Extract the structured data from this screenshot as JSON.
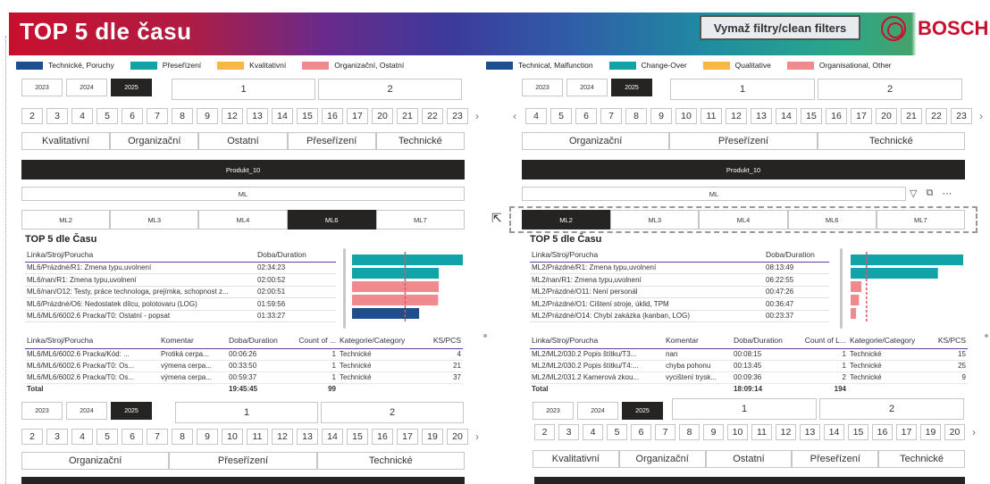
{
  "header": {
    "title": "TOP 5 dle času",
    "clear_filters_label": "Vymaž filtry/clean filters",
    "brand": "BOSCH"
  },
  "legend_cz": [
    {
      "label": "Technické, Poruchy",
      "color": "#1f4e8c"
    },
    {
      "label": "Přeseřízení",
      "color": "#12a3a9"
    },
    {
      "label": "Kvalitativní",
      "color": "#f5b942"
    },
    {
      "label": "Organizační, Ostatní",
      "color": "#f08a8f"
    }
  ],
  "legend_en": [
    {
      "label": "Technical, Malfunction",
      "color": "#1f4e8c"
    },
    {
      "label": "Change-Over",
      "color": "#12a3a9"
    },
    {
      "label": "Qualitative",
      "color": "#f5b942"
    },
    {
      "label": "Organisational, Other",
      "color": "#f08a8f"
    }
  ],
  "left": {
    "years": [
      "2023",
      "2024",
      "2025"
    ],
    "selected_year": "2025",
    "halves": [
      "1",
      "2"
    ],
    "weeks": [
      "2",
      "3",
      "4",
      "5",
      "6",
      "7",
      "8",
      "9",
      "12",
      "13",
      "14",
      "15",
      "16",
      "17",
      "20",
      "21",
      "22",
      "23"
    ],
    "categories": [
      "Kvalitativní",
      "Organizační",
      "Ostatní",
      "Přeseřízení",
      "Technické"
    ],
    "product": "Produkt_10",
    "ml_label": "ML",
    "lines": [
      "ML2",
      "ML3",
      "ML4",
      "ML6",
      "ML7"
    ],
    "selected_line": "ML6",
    "top5": {
      "title": "TOP 5 dle Času",
      "col_line": "Linka/Stroj/Porucha",
      "col_duration": "Doba/Duration",
      "rows": [
        {
          "line": "ML6/Prázdné/R1: Zmena typu,uvolnení",
          "duration": "02:34:23"
        },
        {
          "line": "ML6/nan/R1: Zmena typu,uvolnení",
          "duration": "02:00:52"
        },
        {
          "line": "ML6/nan/O12: Testy, práce technologa, prejímka, schopnost z...",
          "duration": "02:00:51"
        },
        {
          "line": "ML6/Prázdné/O6: Nedostatek dílcu, polotovaru (LOG)",
          "duration": "01:59:56"
        },
        {
          "line": "ML6/ML6/6002.6 Pracka/T0: Ostatní - popsat",
          "duration": "01:33:27"
        }
      ]
    },
    "top5_chart": {
      "values_min": [
        154.4,
        120.9,
        120.9,
        120.0,
        93.5
      ],
      "colors": [
        "#12a3a9",
        "#12a3a9",
        "#f08a8f",
        "#f08a8f",
        "#1f4e8c"
      ],
      "avg_line_min": 74
    },
    "detail": {
      "headers": [
        "Linka/Stroj/Porucha",
        "Komentar",
        "Doba/Duration",
        "Count of ...",
        "Kategorie/Category",
        "KS/PCS"
      ],
      "rows": [
        [
          "ML6/ML6/6002.6 Pracka/Kód: ...",
          "Protiká cerpa...",
          "00:06:26",
          "1",
          "Technické",
          "4"
        ],
        [
          "ML6/ML6/6002.6 Pracka/T0: Os...",
          "výmena cerpa...",
          "00:33:50",
          "1",
          "Technické",
          "21"
        ],
        [
          "ML6/ML6/6002.6 Pracka/T0: Os...",
          "výmena cerpa...",
          "00:59:37",
          "1",
          "Technické",
          "37"
        ]
      ],
      "total": [
        "Total",
        "",
        "19:45:45",
        "99",
        "",
        ""
      ]
    },
    "years2": [
      "2023",
      "2024",
      "2025"
    ],
    "selected_year2": "2025",
    "halves2": [
      "1",
      "2"
    ],
    "weeks2": [
      "2",
      "3",
      "4",
      "5",
      "6",
      "7",
      "8",
      "9",
      "10",
      "11",
      "12",
      "13",
      "14",
      "15",
      "16",
      "17",
      "19",
      "20"
    ],
    "categories2": [
      "Organizační",
      "Přeseřízení",
      "Technické"
    ]
  },
  "right": {
    "years": [
      "2023",
      "2024",
      "2025"
    ],
    "selected_year": "2025",
    "halves": [
      "1",
      "2"
    ],
    "weeks": [
      "4",
      "5",
      "6",
      "7",
      "8",
      "9",
      "10",
      "11",
      "12",
      "13",
      "14",
      "15",
      "16",
      "17",
      "20",
      "21",
      "22",
      "23"
    ],
    "categories": [
      "Organizační",
      "Přeseřízení",
      "Technické"
    ],
    "product": "Produkt_10",
    "ml_label": "ML",
    "lines": [
      "ML2",
      "ML3",
      "ML4",
      "ML6",
      "ML7"
    ],
    "selected_line": "ML2",
    "top5": {
      "title": "TOP 5 dle Času",
      "col_line": "Linka/Stroj/Porucha",
      "col_duration": "Doba/Duration",
      "rows": [
        {
          "line": "ML2/Prázdné/R1: Zmena typu,uvolnení",
          "duration": "08:13:49"
        },
        {
          "line": "ML2/nan/R1: Zmena typu,uvolnení",
          "duration": "06:22:55"
        },
        {
          "line": "ML2/Prázdné/O11: Není personál",
          "duration": "00:47:26"
        },
        {
          "line": "ML2/Prázdné/O1: Cištení stroje, úklid, TPM",
          "duration": "00:36:47"
        },
        {
          "line": "ML2/Prázdné/O14: Chybí zakázka (kanban, LOG)",
          "duration": "00:23:37"
        }
      ]
    },
    "top5_chart": {
      "values_min": [
        493.8,
        382.9,
        47.4,
        36.8,
        23.6
      ],
      "colors": [
        "#12a3a9",
        "#12a3a9",
        "#f08a8f",
        "#f08a8f",
        "#f08a8f"
      ],
      "avg_line_min": 70
    },
    "detail": {
      "headers": [
        "Linka/Stroj/Porucha",
        "Komentar",
        "Doba/Duration",
        "Count of L...",
        "Kategorie/Category",
        "KS/PCS"
      ],
      "rows": [
        [
          "ML2/ML2/030.2 Popis štítku/T3...",
          "nan",
          "00:08:15",
          "1",
          "Technické",
          "15"
        ],
        [
          "ML2/ML2/030.2 Popis štítku/T4:...",
          "chyba pohonu",
          "00:13:45",
          "1",
          "Technické",
          "25"
        ],
        [
          "ML2/ML2/031.2 Kamerová zkou...",
          "vycištení trysk...",
          "00:09:36",
          "2",
          "Technické",
          "9"
        ]
      ],
      "total": [
        "Total",
        "",
        "18:09:14",
        "194",
        "",
        ""
      ]
    },
    "years2": [
      "2023",
      "2024",
      "2025"
    ],
    "selected_year2": "2025",
    "halves2": [
      "1",
      "2"
    ],
    "weeks2": [
      "2",
      "3",
      "4",
      "5",
      "6",
      "7",
      "8",
      "9",
      "10",
      "11",
      "12",
      "13",
      "14",
      "15",
      "16",
      "17",
      "19",
      "20"
    ],
    "categories2": [
      "Kvalitativní",
      "Organizační",
      "Ostatní",
      "Přeseřízení",
      "Technické"
    ]
  }
}
